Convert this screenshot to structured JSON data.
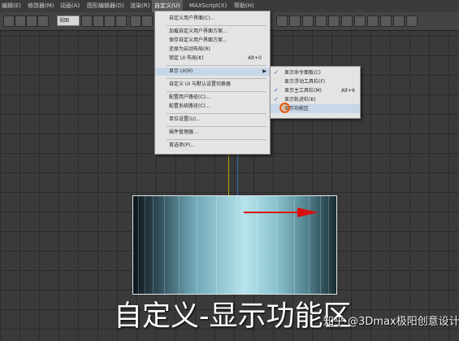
{
  "menubar": {
    "items": [
      "编辑(E)",
      "修改器(M)",
      "动画(A)",
      "图形编辑器(D)",
      "渲染(R)",
      "自定义(U)",
      "MAXScript(X)",
      "帮助(H)"
    ]
  },
  "toolbar": {
    "view_dropdown": "视图"
  },
  "customize_menu": {
    "items": [
      {
        "label": "自定义用户界面(C)...",
        "shortcut": ""
      },
      {
        "label": "加载自定义用户界面方案...",
        "shortcut": ""
      },
      {
        "label": "保存自定义用户界面方案...",
        "shortcut": ""
      },
      {
        "label": "还原为启动布局(R)",
        "shortcut": ""
      },
      {
        "label": "锁定 UI 布局(K)",
        "shortcut": "Alt+0"
      },
      {
        "label": "显示 UI(H)",
        "shortcut": ""
      },
      {
        "label": "自定义 UI 与默认设置切换器",
        "shortcut": ""
      },
      {
        "label": "配置用户路径(C)...",
        "shortcut": ""
      },
      {
        "label": "配置系统路径(C)...",
        "shortcut": ""
      },
      {
        "label": "单位设置(U)...",
        "shortcut": ""
      },
      {
        "label": "插件管理器...",
        "shortcut": ""
      },
      {
        "label": "首选项(P)...",
        "shortcut": ""
      }
    ]
  },
  "show_ui_submenu": {
    "items": [
      {
        "label": "显示命令面板(C)",
        "checked": true,
        "shortcut": ""
      },
      {
        "label": "显示浮动工具栏(F)",
        "checked": false,
        "shortcut": ""
      },
      {
        "label": "显示主工具栏(M)",
        "checked": true,
        "shortcut": "Alt+6"
      },
      {
        "label": "显示轨迹栏(K)",
        "checked": true,
        "shortcut": ""
      },
      {
        "label": "显示功能区",
        "checked": false,
        "shortcut": ""
      }
    ]
  },
  "caption": "自定义-显示功能区",
  "watermark": "知乎 @3Dmax极阳创意设计",
  "colors": {
    "menu_bg": "#e4e4e4",
    "highlight": "#c8d7e8",
    "cylinder": "#8cc4cf",
    "gizmo_arrow": "#d81010"
  }
}
